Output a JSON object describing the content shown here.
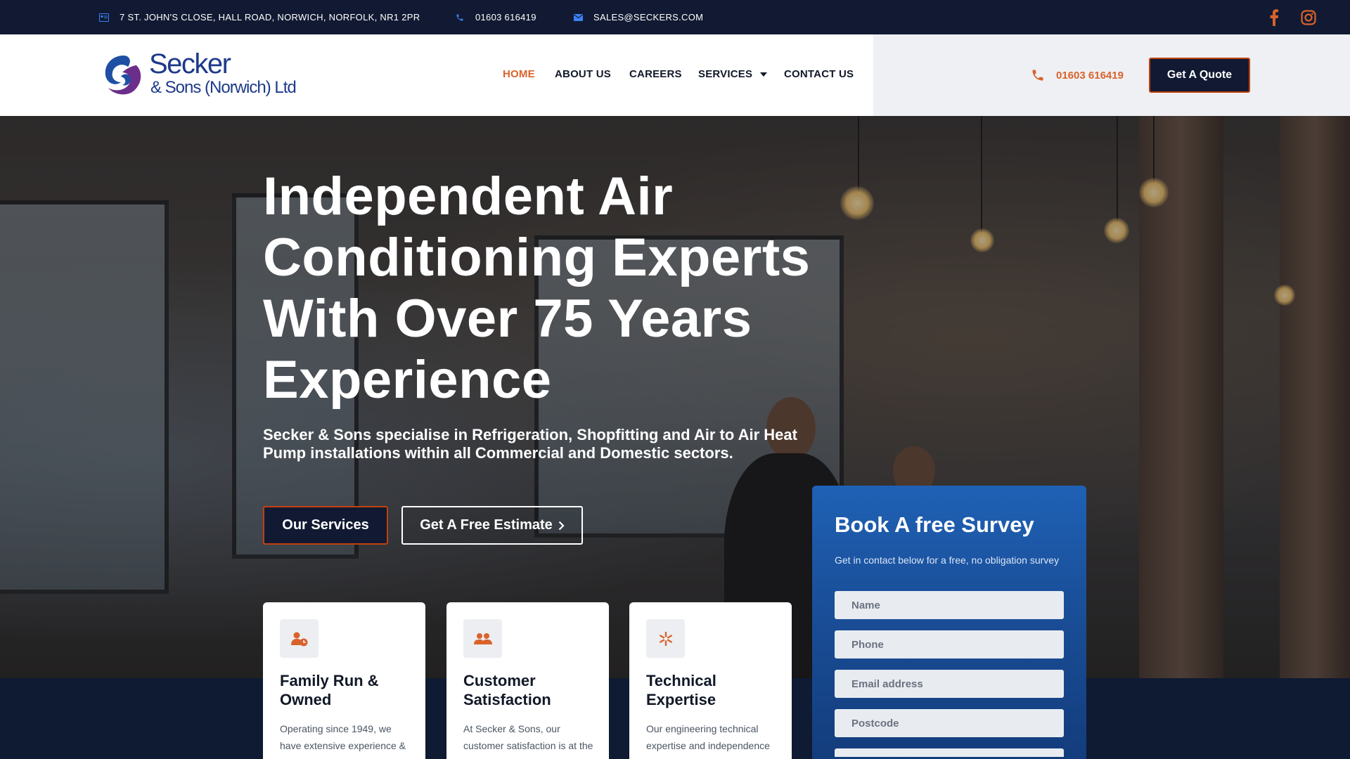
{
  "topbar": {
    "address": "7 ST. JOHN'S CLOSE, HALL ROAD, NORWICH, NORFOLK, NR1 2PR",
    "phone": "01603 616419",
    "email": "SALES@SECKERS.COM"
  },
  "logo": {
    "line1": "Secker",
    "line2": "& Sons (Norwich) Ltd"
  },
  "nav": {
    "home": "HOME",
    "about": "ABOUT US",
    "careers": "CAREERS",
    "services": "SERVICES",
    "contact": "CONTACT US"
  },
  "header": {
    "phone": "01603 616419",
    "quote_label": "Get A Quote"
  },
  "hero": {
    "title": "Independent Air Conditioning Experts With Over 75 Years Experience",
    "subtitle": "Secker & Sons specialise in Refrigeration, Shopfitting and Air to Air Heat Pump installations within all Commercial and Domestic sectors.",
    "services_label": "Our Services",
    "estimate_label": "Get A Free Estimate"
  },
  "cards": [
    {
      "title": "Family Run & Owned",
      "desc": "Operating since 1949, we have extensive experience &"
    },
    {
      "title": "Customer Satisfaction",
      "desc": "At Secker & Sons, our customer satisfaction is at the"
    },
    {
      "title": "Technical Expertise",
      "desc": "Our engineering technical expertise and independence"
    }
  ],
  "survey": {
    "title": "Book A free Survey",
    "desc": "Get in contact below for a free, no obligation survey",
    "name_placeholder": "Name",
    "phone_placeholder": "Phone",
    "email_placeholder": "Email address",
    "postcode_placeholder": "Postcode"
  },
  "colors": {
    "accent": "#d9622b",
    "navy": "#111a32",
    "blue": "#1f61b5"
  }
}
